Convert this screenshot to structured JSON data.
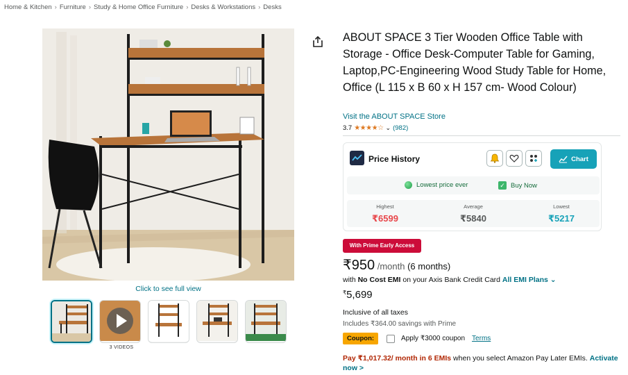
{
  "breadcrumbs": [
    "Home & Kitchen",
    "Furniture",
    "Study & Home Office Furniture",
    "Desks & Workstations",
    "Desks"
  ],
  "gallery": {
    "full_view_label": "Click to see full view",
    "videos_label": "3 VIDEOS"
  },
  "product": {
    "title": "ABOUT SPACE 3 Tier Wooden Office Table with Storage - Office Desk-Computer Table for Gaming, Laptop,PC-Engineering Wood Study Table for Home, Office (L 115 x B 60 x H 157 cm- Wood Colour)",
    "store_link": "Visit the ABOUT SPACE Store",
    "rating_value": "3.7",
    "rating_count": "(982)"
  },
  "price_history": {
    "title": "Price History",
    "chart_label": "Chart",
    "lowest_ever_label": "Lowest price ever",
    "buy_now_label": "Buy Now",
    "highest_label": "Highest",
    "highest_value": "₹6599",
    "average_label": "Average",
    "average_value": "₹5840",
    "lowest_label": "Lowest",
    "lowest_value": "₹5217",
    "colors": {
      "highest": "#e8474b",
      "average": "#565959",
      "lowest": "#17a2b8",
      "chart_button": "#17a2b8"
    }
  },
  "pricing": {
    "prime_badge": "With Prime Early Access",
    "emi_amount": "₹950",
    "emi_suffix": "/month",
    "emi_term": "(6 months)",
    "no_cost_prefix": "with ",
    "no_cost_bold": "No Cost EMI",
    "no_cost_suffix": " on your Axis Bank Credit Card ",
    "all_emi_label": "All EMI Plans",
    "mrp_symbol": "₹",
    "mrp_value": "5,699",
    "taxes": "Inclusive of all taxes",
    "savings": "Includes ₹364.00 savings with Prime",
    "coupon_tag": "Coupon:",
    "coupon_text": "Apply ₹3000 coupon",
    "coupon_terms": "Terms",
    "pay_later_prefix": "Pay ",
    "pay_later_amount": "₹1,017.32/ month in 6 EMIs",
    "pay_later_middle": " when you select Amazon Pay Later EMIs. ",
    "pay_later_action": "Activate now >",
    "colors": {
      "prime_badge": "#cc0c39",
      "coupon_tag": "#f7a600",
      "link": "#007185",
      "emi_red": "#b12704"
    }
  },
  "icons": [
    "share-icon",
    "bell-icon",
    "heart-icon",
    "grid-icon",
    "chart-icon",
    "play-icon",
    "chevron-down-icon",
    "star-icon"
  ]
}
